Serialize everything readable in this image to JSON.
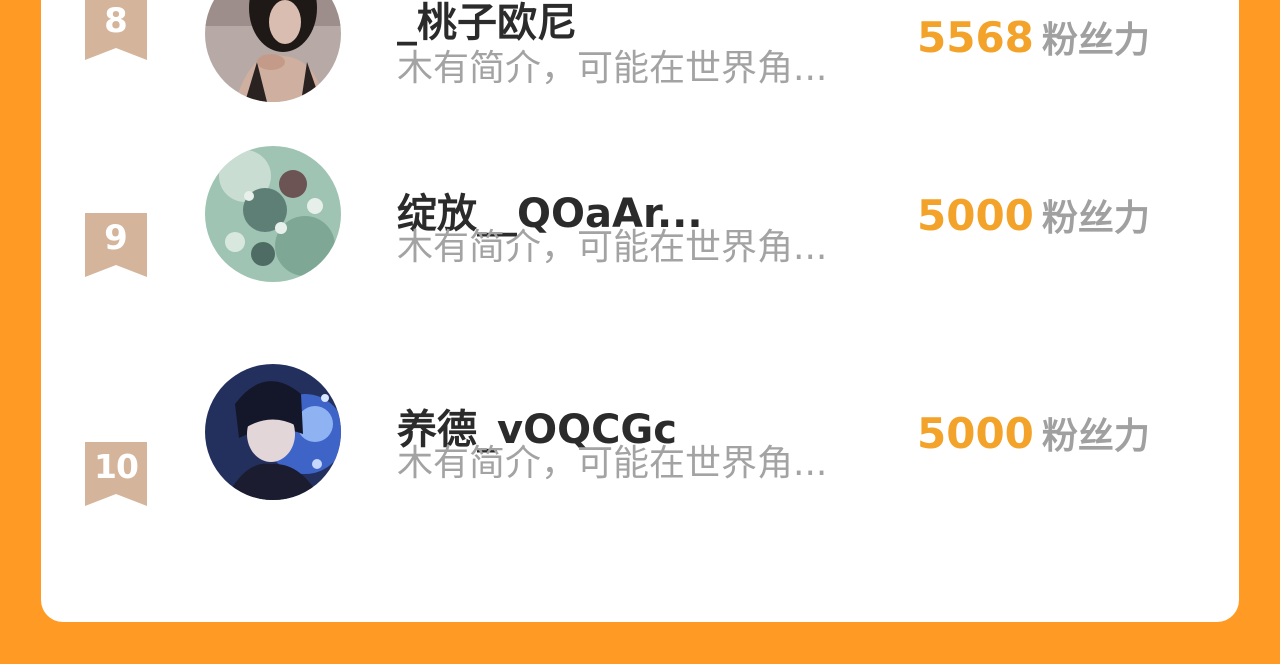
{
  "ranking": [
    {
      "rank": "8",
      "name": "_桃子欧尼",
      "bio": "木有简介，可能在世界角...",
      "fans": "5568",
      "fans_unit": "粉丝力",
      "avatar": "avatar-girl-dark-portrait"
    },
    {
      "rank": "9",
      "name": "绽放__QOaAr...",
      "bio": "木有简介，可能在世界角...",
      "fans": "5000",
      "fans_unit": "粉丝力",
      "avatar": "avatar-jeweled-decoration"
    },
    {
      "rank": "10",
      "name": "养德_vOQCGc",
      "bio": "木有简介，可能在世界角...",
      "fans": "5000",
      "fans_unit": "粉丝力",
      "avatar": "avatar-anime-boy"
    }
  ],
  "colors": {
    "background": "#FF9A24",
    "card": "#FFFFFF",
    "rank_badge": "#D4B49A",
    "fans_value": "#F3A22A",
    "fans_unit": "#A0A0A0",
    "name": "#2B2B2B",
    "bio": "#A3A3A3"
  }
}
